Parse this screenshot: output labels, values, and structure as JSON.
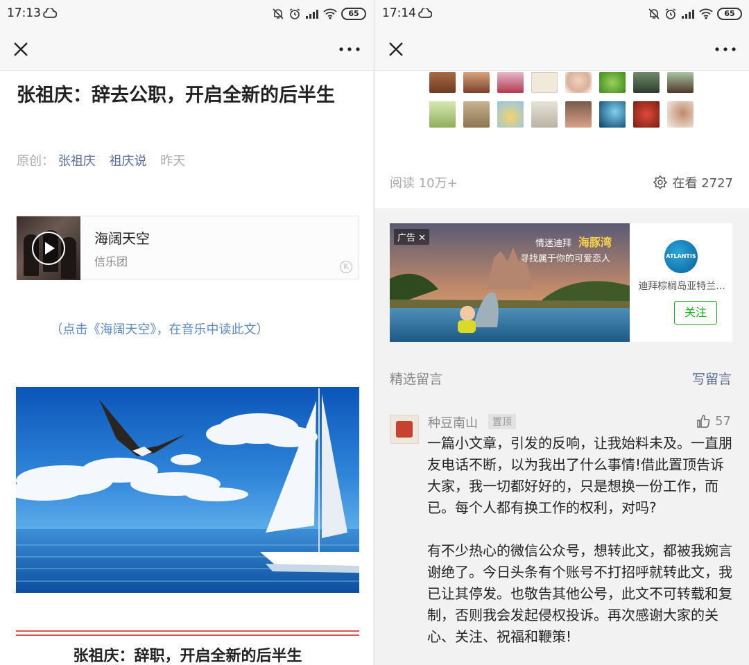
{
  "left": {
    "status": {
      "time": "17:13",
      "battery": "65"
    },
    "article": {
      "title": "张祖庆：辞去公职，开启全新的后半生",
      "meta_original": "原创：",
      "meta_author": "张祖庆",
      "meta_account": "祖庆说",
      "meta_time": "昨天"
    },
    "music": {
      "song": "海阔天空",
      "artist": "信乐团"
    },
    "music_hint": "（点击《海阔天空》，在音乐中读此文）",
    "sub_title": "张祖庆：辞职，开启全新的后半生"
  },
  "right": {
    "status": {
      "time": "17:14",
      "battery": "65"
    },
    "stats": {
      "reads": "阅读 10万+",
      "looking": "在看 2727"
    },
    "ad": {
      "tag": "广告",
      "line1": "情迷迪拜",
      "headline": "海豚湾",
      "line2": "寻找属于你的可爱恋人",
      "logo_text": "ATLANTIS",
      "name": "迪拜棕榈岛亚特兰...",
      "follow": "关注"
    },
    "comments_header": {
      "title": "精选留言",
      "write": "写留言"
    },
    "comment": {
      "user": "种豆南山",
      "pin": "置顶",
      "likes": "57",
      "para1": "一篇小文章，引发的反响，让我始料未及。一直朋友电话不断，以为我出了什么事情!借此置顶告诉大家，我一切都好好的，只是想换一份工作，而已。每个人都有换工作的权利，对吗?",
      "para2": "有不少热心的微信公众号，想转此文，都被我婉言谢绝了。今日头条有个账号不打招呼就转此文，我已让其停发。也敬告其他公号，此文不可转载和复制，否则我会发起侵权投诉。再次感谢大家的关心、关注、祝福和鞭策!"
    }
  }
}
